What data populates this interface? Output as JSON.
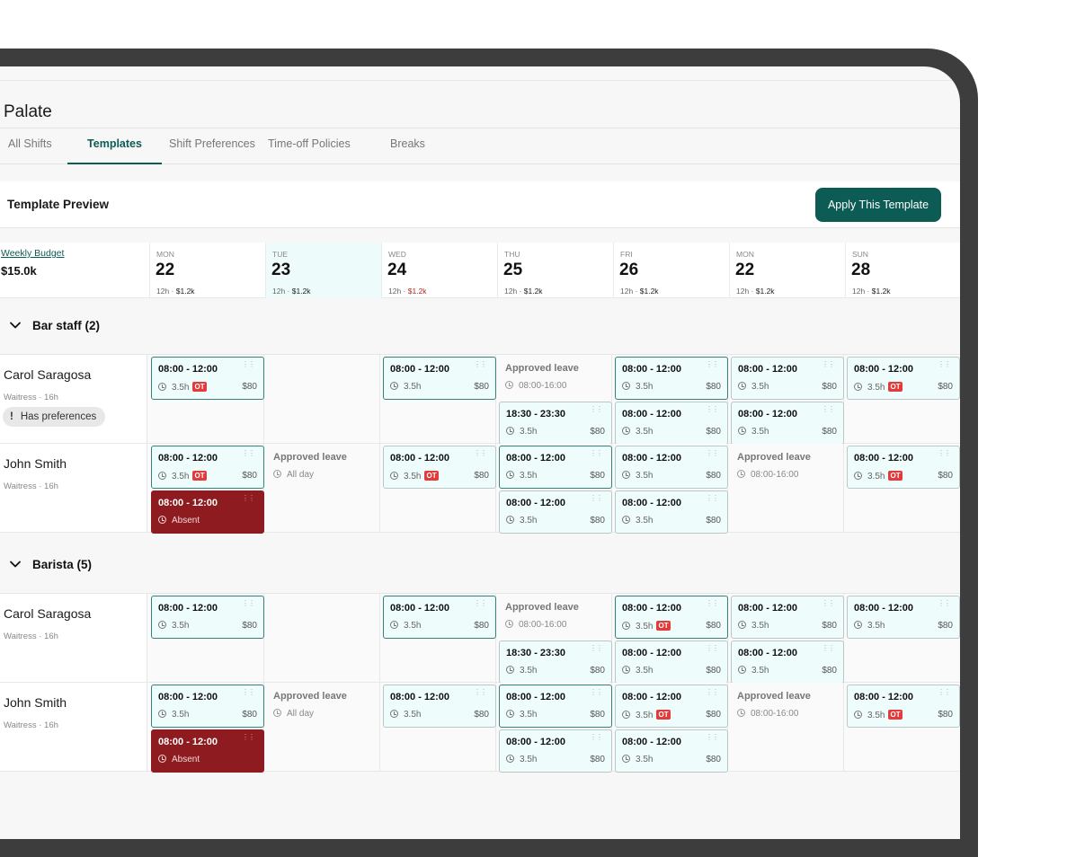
{
  "app": {
    "title": "Palate"
  },
  "tabs": [
    {
      "label": "All Shifts"
    },
    {
      "label": "Templates"
    },
    {
      "label": "Shift Preferences"
    },
    {
      "label": "Time-off Policies"
    },
    {
      "label": "Breaks"
    }
  ],
  "preview": {
    "title": "Template Preview",
    "apply_label": "Apply This Template"
  },
  "budget": {
    "label": "Weekly Budget",
    "value": "$15.0k"
  },
  "days": [
    {
      "abbr": "MON",
      "num": "22",
      "hours": "12h",
      "cost": "$1.2k"
    },
    {
      "abbr": "TUE",
      "num": "23",
      "hours": "12h",
      "cost": "$1.2k"
    },
    {
      "abbr": "WED",
      "num": "24",
      "hours": "12h",
      "cost": "$1.2k"
    },
    {
      "abbr": "THU",
      "num": "25",
      "hours": "12h",
      "cost": "$1.2k"
    },
    {
      "abbr": "FRI",
      "num": "26",
      "hours": "12h",
      "cost": "$1.2k"
    },
    {
      "abbr": "MON",
      "num": "22",
      "hours": "12h",
      "cost": "$1.2k"
    },
    {
      "abbr": "SUN",
      "num": "28",
      "hours": "12h",
      "cost": "$1.2k"
    }
  ],
  "colors": {
    "accent": "#0c5c55",
    "absent": "#8e1b1f",
    "ot": "#e33b3b",
    "over_budget": "#b02a2a"
  },
  "groups": [
    {
      "label": "Bar staff (2)",
      "rows": [
        {
          "name": "Carol Saragosa",
          "role": "Waitress · 16h",
          "pref": "Has preferences",
          "shifts": [
            {
              "day": 0,
              "slot": 0,
              "time": "08:00 - 12:00",
              "hours": "3.5h",
              "cost": "$80",
              "ot": "OT"
            },
            {
              "day": 2,
              "slot": 0,
              "time": "08:00 - 12:00",
              "hours": "3.5h",
              "cost": "$80"
            },
            {
              "day": 3,
              "slot": 0,
              "kind": "leave",
              "time": "Approved leave",
              "hours": "08:00-16:00"
            },
            {
              "day": 3,
              "slot": 1,
              "time": "18:30 - 23:30",
              "hours": "3.5h",
              "cost": "$80",
              "light": true
            },
            {
              "day": 4,
              "slot": 0,
              "time": "08:00 - 12:00",
              "hours": "3.5h",
              "cost": "$80"
            },
            {
              "day": 4,
              "slot": 1,
              "time": "08:00 - 12:00",
              "hours": "3.5h",
              "cost": "$80",
              "light": true
            },
            {
              "day": 5,
              "slot": 0,
              "time": "08:00 - 12:00",
              "hours": "3.5h",
              "cost": "$80",
              "light": true
            },
            {
              "day": 5,
              "slot": 1,
              "time": "08:00 - 12:00",
              "hours": "3.5h",
              "cost": "$80",
              "light": true
            },
            {
              "day": 6,
              "slot": 0,
              "time": "08:00 - 12:00",
              "hours": "3.5h",
              "cost": "$80",
              "ot": "OT",
              "light": true
            }
          ]
        },
        {
          "name": "John Smith",
          "role": "Waitress · 16h",
          "shifts": [
            {
              "day": 0,
              "slot": 0,
              "time": "08:00 - 12:00",
              "hours": "3.5h",
              "cost": "$80",
              "ot": "OT"
            },
            {
              "day": 0,
              "slot": 1,
              "kind": "absent",
              "time": "08:00 - 12:00",
              "hours": "Absent"
            },
            {
              "day": 1,
              "slot": 0,
              "kind": "leave",
              "time": "Approved leave",
              "hours": "All day"
            },
            {
              "day": 2,
              "slot": 0,
              "time": "08:00 - 12:00",
              "hours": "3.5h",
              "cost": "$80",
              "ot": "OT",
              "light": true
            },
            {
              "day": 3,
              "slot": 0,
              "time": "08:00 - 12:00",
              "hours": "3.5h",
              "cost": "$80"
            },
            {
              "day": 3,
              "slot": 1,
              "time": "08:00 - 12:00",
              "hours": "3.5h",
              "cost": "$80",
              "light": true
            },
            {
              "day": 4,
              "slot": 0,
              "time": "08:00 - 12:00",
              "hours": "3.5h",
              "cost": "$80",
              "light": true
            },
            {
              "day": 4,
              "slot": 1,
              "time": "08:00 - 12:00",
              "hours": "3.5h",
              "cost": "$80",
              "light": true
            },
            {
              "day": 5,
              "slot": 0,
              "kind": "leave",
              "time": "Approved leave",
              "hours": "08:00-16:00"
            },
            {
              "day": 6,
              "slot": 0,
              "time": "08:00 - 12:00",
              "hours": "3.5h",
              "cost": "$80",
              "ot": "OT",
              "light": true
            }
          ]
        }
      ]
    },
    {
      "label": "Barista (5)",
      "rows": [
        {
          "name": "Carol Saragosa",
          "role": "Waitress · 16h",
          "shifts": [
            {
              "day": 0,
              "slot": 0,
              "time": "08:00 - 12:00",
              "hours": "3.5h",
              "cost": "$80"
            },
            {
              "day": 2,
              "slot": 0,
              "time": "08:00 - 12:00",
              "hours": "3.5h",
              "cost": "$80"
            },
            {
              "day": 3,
              "slot": 0,
              "kind": "leave",
              "time": "Approved leave",
              "hours": "08:00-16:00"
            },
            {
              "day": 3,
              "slot": 1,
              "time": "18:30 - 23:30",
              "hours": "3.5h",
              "cost": "$80",
              "light": true
            },
            {
              "day": 4,
              "slot": 0,
              "time": "08:00 - 12:00",
              "hours": "3.5h",
              "cost": "$80",
              "ot": "OT"
            },
            {
              "day": 4,
              "slot": 1,
              "time": "08:00 - 12:00",
              "hours": "3.5h",
              "cost": "$80",
              "light": true
            },
            {
              "day": 5,
              "slot": 0,
              "time": "08:00 - 12:00",
              "hours": "3.5h",
              "cost": "$80",
              "light": true
            },
            {
              "day": 5,
              "slot": 1,
              "time": "08:00 - 12:00",
              "hours": "3.5h",
              "cost": "$80",
              "light": true
            },
            {
              "day": 6,
              "slot": 0,
              "time": "08:00 - 12:00",
              "hours": "3.5h",
              "cost": "$80",
              "light": true
            }
          ]
        },
        {
          "name": "John Smith",
          "role": "Waitress · 16h",
          "shifts": [
            {
              "day": 0,
              "slot": 0,
              "time": "08:00 - 12:00",
              "hours": "3.5h",
              "cost": "$80"
            },
            {
              "day": 0,
              "slot": 1,
              "kind": "absent",
              "time": "08:00 - 12:00",
              "hours": "Absent"
            },
            {
              "day": 1,
              "slot": 0,
              "kind": "leave",
              "time": "Approved leave",
              "hours": "All day"
            },
            {
              "day": 2,
              "slot": 0,
              "time": "08:00 - 12:00",
              "hours": "3.5h",
              "cost": "$80",
              "light": true
            },
            {
              "day": 3,
              "slot": 0,
              "time": "08:00 - 12:00",
              "hours": "3.5h",
              "cost": "$80"
            },
            {
              "day": 3,
              "slot": 1,
              "time": "08:00 - 12:00",
              "hours": "3.5h",
              "cost": "$80",
              "light": true
            },
            {
              "day": 4,
              "slot": 0,
              "time": "08:00 - 12:00",
              "hours": "3.5h",
              "cost": "$80",
              "ot": "OT",
              "light": true
            },
            {
              "day": 4,
              "slot": 1,
              "time": "08:00 - 12:00",
              "hours": "3.5h",
              "cost": "$80",
              "light": true
            },
            {
              "day": 5,
              "slot": 0,
              "kind": "leave",
              "time": "Approved leave",
              "hours": "08:00-16:00"
            },
            {
              "day": 6,
              "slot": 0,
              "time": "08:00 - 12:00",
              "hours": "3.5h",
              "cost": "$80",
              "ot": "OT",
              "light": true
            }
          ]
        }
      ]
    }
  ]
}
